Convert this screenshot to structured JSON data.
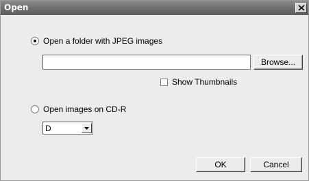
{
  "window": {
    "title": "Open"
  },
  "option_folder": {
    "label": "Open a folder with JPEG images",
    "selected": true
  },
  "folder_path": {
    "value": ""
  },
  "browse_button": {
    "label": "Browse..."
  },
  "show_thumbnails": {
    "label": "Show Thumbnails",
    "checked": false
  },
  "option_cd": {
    "label": "Open images on CD-R",
    "selected": false
  },
  "drive_select": {
    "value": "D"
  },
  "ok_button": {
    "label": "OK"
  },
  "cancel_button": {
    "label": "Cancel"
  }
}
